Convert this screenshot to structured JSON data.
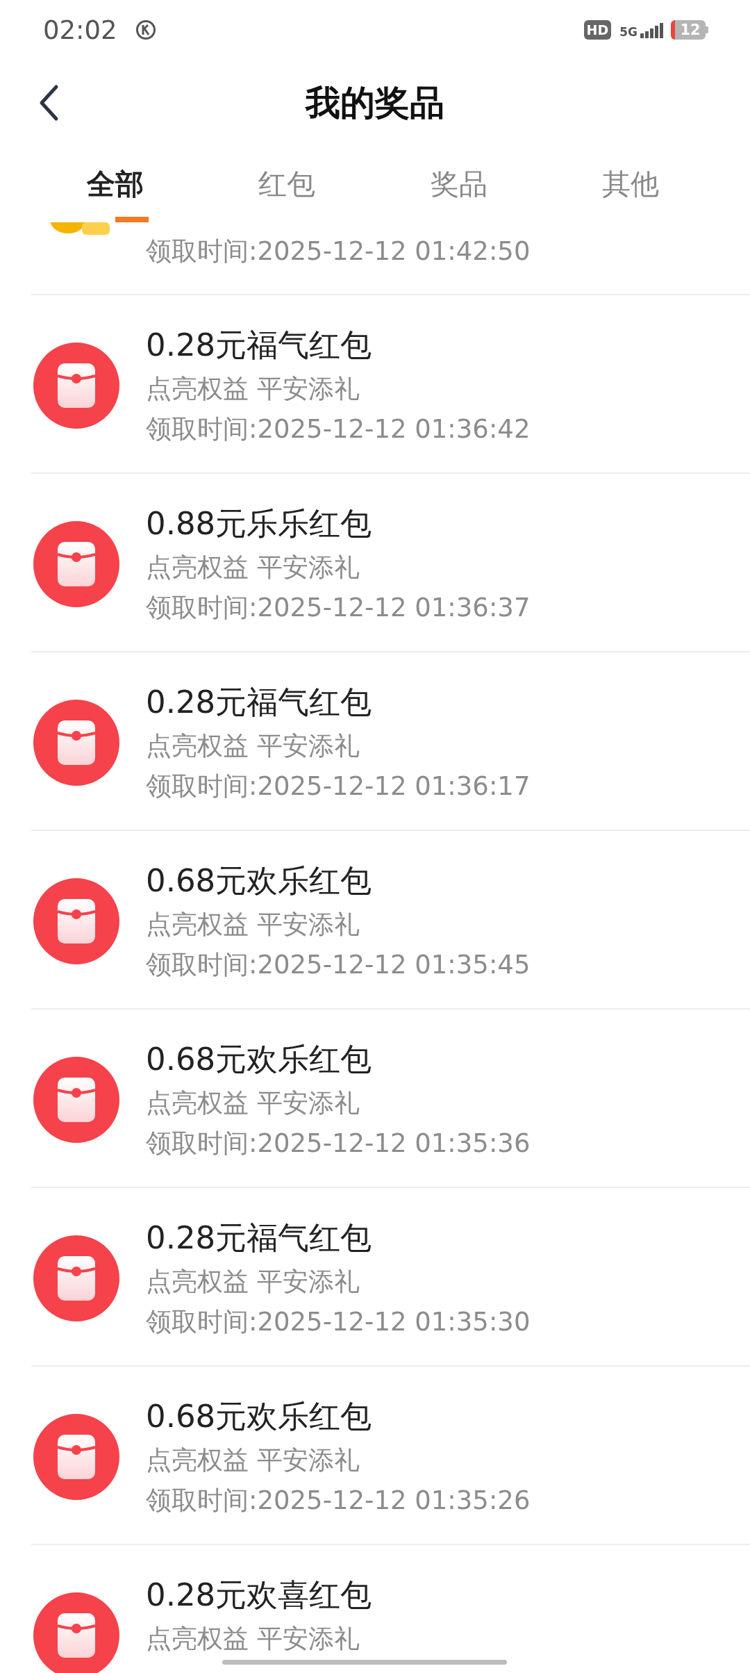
{
  "status_bar": {
    "time": "02:02",
    "network_badge": "HD",
    "network_type": "5G",
    "battery": "12"
  },
  "header": {
    "title": "我的奖品"
  },
  "tabs": [
    {
      "label": "全部",
      "selected": true
    },
    {
      "label": "红包",
      "selected": false
    },
    {
      "label": "奖品",
      "selected": false
    },
    {
      "label": "其他",
      "selected": false
    }
  ],
  "items": [
    {
      "kind": "coin",
      "time": "领取时间:2025-12-12 01:42:50"
    },
    {
      "kind": "red_packet",
      "title": "0.28元福气红包",
      "subtitle": "点亮权益 平安添礼",
      "time": "领取时间:2025-12-12 01:36:42"
    },
    {
      "kind": "red_packet",
      "title": "0.88元乐乐红包",
      "subtitle": "点亮权益 平安添礼",
      "time": "领取时间:2025-12-12 01:36:37"
    },
    {
      "kind": "red_packet",
      "title": "0.28元福气红包",
      "subtitle": "点亮权益 平安添礼",
      "time": "领取时间:2025-12-12 01:36:17"
    },
    {
      "kind": "red_packet",
      "title": "0.68元欢乐红包",
      "subtitle": "点亮权益 平安添礼",
      "time": "领取时间:2025-12-12 01:35:45"
    },
    {
      "kind": "red_packet",
      "title": "0.68元欢乐红包",
      "subtitle": "点亮权益 平安添礼",
      "time": "领取时间:2025-12-12 01:35:36"
    },
    {
      "kind": "red_packet",
      "title": "0.28元福气红包",
      "subtitle": "点亮权益 平安添礼",
      "time": "领取时间:2025-12-12 01:35:30"
    },
    {
      "kind": "red_packet",
      "title": "0.68元欢乐红包",
      "subtitle": "点亮权益 平安添礼",
      "time": "领取时间:2025-12-12 01:35:26"
    },
    {
      "kind": "red_packet",
      "title": "0.28元欢喜红包",
      "subtitle": "点亮权益 平安添礼"
    }
  ]
}
